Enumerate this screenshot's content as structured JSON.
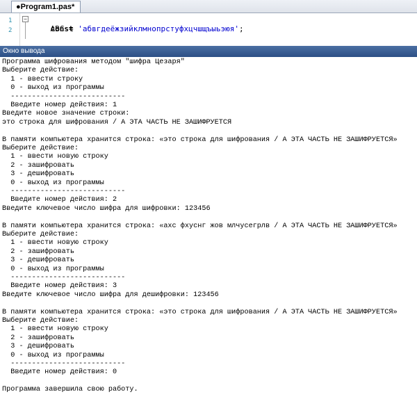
{
  "tab": {
    "label": "●Program1.pas*"
  },
  "editor": {
    "line_numbers": [
      "1",
      "2"
    ],
    "fold_icon": "minus-box",
    "line1_keyword": "const",
    "line2_prefix": "    ABC = ",
    "line2_string": "'абвгдеёжзийклмнопрстуфхцчшщъыьэюя'",
    "line2_suffix": ";"
  },
  "output_panel": {
    "title": "Окно вывода",
    "lines": [
      "Программа шифрования методом \"шифра Цезаря\"",
      "Выберите действие:",
      "  1 - ввести строку",
      "  0 - выход из программы",
      "  ---------------------------",
      "  Введите номер действия: 1",
      "Введите новое значение строки:",
      "это строка для шифрования / А ЭТА ЧАСТЬ НЕ ЗАШИФРУЕТСЯ",
      "",
      "В памяти компьютера хранится строка: «это строка для шифрования / А ЭТА ЧАСТЬ НЕ ЗАШИФРУЕТСЯ»",
      "Выберите действие:",
      "  1 - ввести новую строку",
      "  2 - зашифровать",
      "  3 - дешифровать",
      "  0 - выход из программы",
      "  ---------------------------",
      "  Введите номер действия: 2",
      "Введите ключевое число шифра для шифровки: 123456",
      "",
      "В памяти компьютера хранится строка: «ахс фхуснг жов млчусегрлв / А ЭТА ЧАСТЬ НЕ ЗАШИФРУЕТСЯ»",
      "Выберите действие:",
      "  1 - ввести новую строку",
      "  2 - зашифровать",
      "  3 - дешифровать",
      "  0 - выход из программы",
      "  ---------------------------",
      "  Введите номер действия: 3",
      "Введите ключевое число шифра для дешифровки: 123456",
      "",
      "В памяти компьютера хранится строка: «это строка для шифрования / А ЭТА ЧАСТЬ НЕ ЗАШИФРУЕТСЯ»",
      "Выберите действие:",
      "  1 - ввести новую строку",
      "  2 - зашифровать",
      "  3 - дешифровать",
      "  0 - выход из программы",
      "  ---------------------------",
      "  Введите номер действия: 0",
      "",
      "Программа завершила свою работу."
    ]
  }
}
